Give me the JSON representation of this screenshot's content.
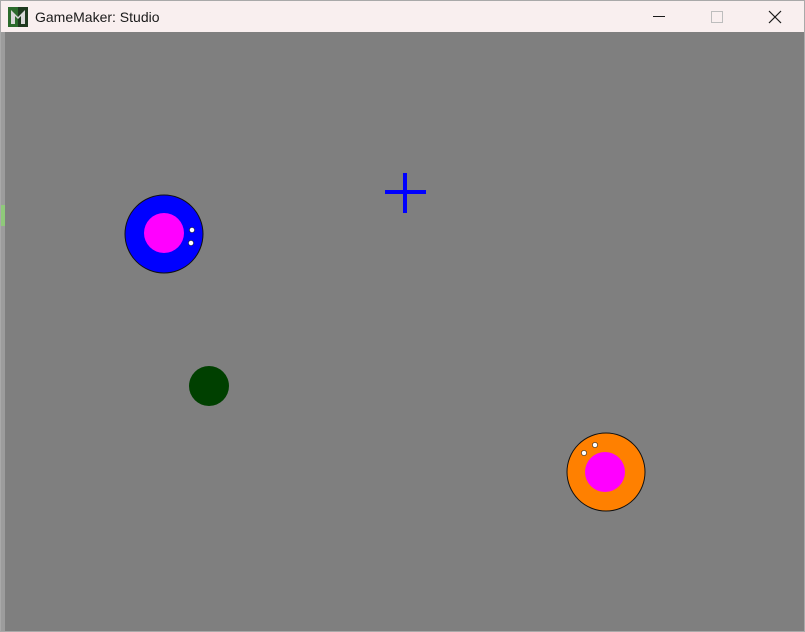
{
  "window": {
    "title": "GameMaker: Studio",
    "controls": {
      "minimize_icon": "minimize-icon",
      "maximize_icon": "maximize-icon",
      "close_icon": "close-icon"
    }
  },
  "game": {
    "background_color": "#7f7f7f",
    "entities": {
      "player_blue": {
        "body_color": "#0000ff",
        "core_color": "#ff00ff",
        "eye_color": "#ffffff"
      },
      "enemy_orange": {
        "body_color": "#ff8000",
        "core_color": "#ff00ff",
        "eye_color": "#ffffff"
      },
      "pickup_green": {
        "color": "#004000"
      },
      "crosshair": {
        "color": "#0000ff"
      }
    }
  }
}
